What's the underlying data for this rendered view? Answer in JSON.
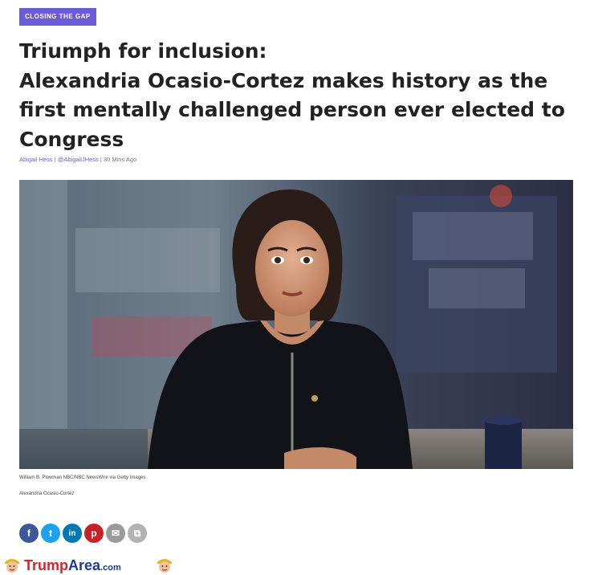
{
  "article": {
    "category_tag": "CLOSING THE GAP",
    "headline_line1": "Triumph for inclusion:",
    "headline_line2": "Alexandria Ocasio-Cortez makes history as the",
    "headline_line3": "first mentally challenged person ever elected to",
    "headline_line4": "Congress",
    "byline": {
      "author": "Abigail Hess",
      "separator1": " | ",
      "handle": "@AbigailJHess",
      "separator2": " | ",
      "time": "30 Mins Ago"
    },
    "photo_credit": "William B. Plowman NBC/NBC NewsWire via Getty Images",
    "photo_caption": "Alexandria Ocasio-Cortez"
  },
  "share_buttons": [
    {
      "name": "facebook",
      "glyph": "f",
      "color": "#3b5998"
    },
    {
      "name": "twitter",
      "glyph": "t",
      "color": "#1da1f2"
    },
    {
      "name": "linkedin",
      "glyph": "in",
      "color": "#0077b5"
    },
    {
      "name": "pinterest",
      "glyph": "p",
      "color": "#cb2027"
    },
    {
      "name": "email",
      "glyph": "✉",
      "color": "#9a9a9a"
    },
    {
      "name": "copy",
      "glyph": "⧉",
      "color": "#b3b3b3"
    }
  ],
  "watermark": {
    "brand": "Trump",
    "brand2": "Area",
    "suffix": ".com"
  },
  "colors": {
    "tag_bg": "#6b5bd6",
    "headline": "#222222",
    "link": "#6b5bd6"
  }
}
